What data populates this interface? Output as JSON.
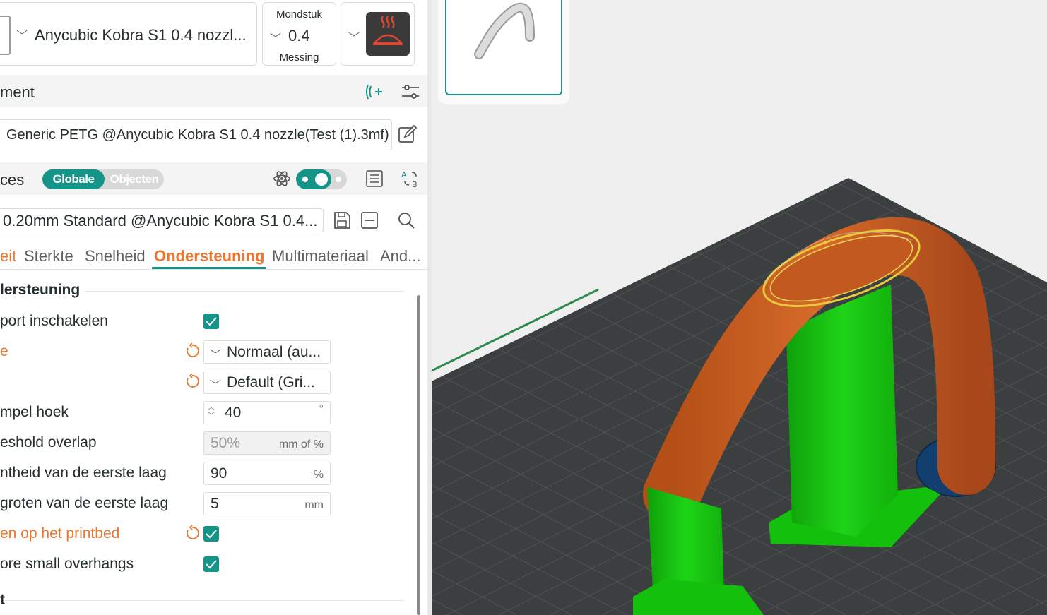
{
  "printer": {
    "name": "Anycubic Kobra S1 0.4 nozzl...",
    "nozzle_label": "Mondstuk",
    "nozzle_size": "0.4",
    "nozzle_material": "Messing"
  },
  "filament": {
    "section_title": "ment",
    "preset": "Generic PETG @Anycubic Kobra S1 0.4 nozzle(Test (1).3mf)"
  },
  "process": {
    "section_title": "ces",
    "toggle_global": "Globale",
    "toggle_objects": "Objecten",
    "preset": "0.20mm Standard @Anycubic Kobra S1 0.4..."
  },
  "tabs": [
    {
      "label": "eit"
    },
    {
      "label": "Sterkte"
    },
    {
      "label": "Snelheid"
    },
    {
      "label": "Ondersteuning"
    },
    {
      "label": "Multimateriaal"
    },
    {
      "label": "And..."
    }
  ],
  "support": {
    "group_title": "lersteuning",
    "rows": [
      {
        "label": "port inschakelen",
        "checked": true
      },
      {
        "label": "e",
        "value": "Normaal (au..."
      },
      {
        "label": "",
        "value": "Default (Gri..."
      },
      {
        "label": "mpel hoek",
        "value": "40",
        "unit": "°"
      },
      {
        "label": "eshold overlap",
        "value": "50%",
        "unit": "mm of %"
      },
      {
        "label": "ntheid van de eerste laag",
        "value": "90",
        "unit": "%"
      },
      {
        "label": "groten van de eerste laag",
        "value": "5",
        "unit": "mm"
      },
      {
        "label": "en op het printbed",
        "checked": true
      },
      {
        "label": "ore small overhangs",
        "checked": true
      }
    ],
    "next_group_title": "t"
  },
  "colors": {
    "accent": "#159488",
    "modified": "#f0752c",
    "model": "#c85a1e",
    "support": "#17c80f",
    "bed": "#3c3f40"
  }
}
